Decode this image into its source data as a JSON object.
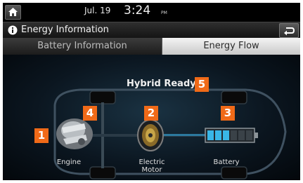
{
  "status": {
    "date": "Jul. 19",
    "time": "3:24",
    "ampm": "PM"
  },
  "header": {
    "title": "Energy Information"
  },
  "tabs": [
    {
      "label": "Battery Information",
      "active": false
    },
    {
      "label": "Energy Flow",
      "active": true
    }
  ],
  "energy_flow": {
    "status_text": "Hybrid Ready",
    "components": [
      {
        "label": "Engine"
      },
      {
        "label": "Electric\nMotor"
      },
      {
        "label": "Battery"
      }
    ],
    "badges": [
      "1",
      "2",
      "3",
      "4",
      "5"
    ]
  },
  "colors": {
    "badge": "#f06a18",
    "flow": "#2ea3d9",
    "battery_fill": "#39b6e6"
  }
}
